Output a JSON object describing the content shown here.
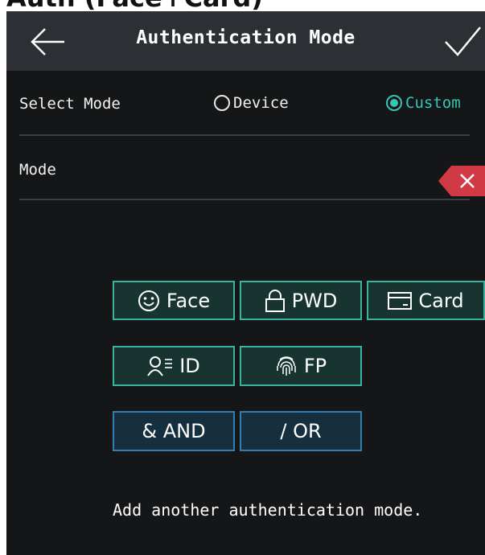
{
  "clipped_top_text": "Auth (Face+Card)",
  "header": {
    "title": "Authentication Mode"
  },
  "select_mode": {
    "label": "Select Mode",
    "options": [
      {
        "label": "Device",
        "selected": false
      },
      {
        "label": "Custom",
        "selected": true
      }
    ]
  },
  "mode": {
    "label": "Mode",
    "value": ""
  },
  "mode_buttons": [
    {
      "label": "Face",
      "icon": "face-icon"
    },
    {
      "label": "PWD",
      "icon": "lock-icon"
    },
    {
      "label": "Card",
      "icon": "card-icon"
    },
    {
      "label": "ID",
      "icon": "person-id-icon"
    },
    {
      "label": "FP",
      "icon": "fingerprint-icon"
    }
  ],
  "logic_buttons": [
    {
      "label": "& AND"
    },
    {
      "label": "/ OR"
    }
  ],
  "hint": "Add another authentication mode.",
  "colors": {
    "accent": "#35c6b6",
    "header_bg": "#2c2f34",
    "screen_bg": "#141618",
    "delete_red": "#d13a45",
    "logic_border": "#2f7fb3"
  }
}
